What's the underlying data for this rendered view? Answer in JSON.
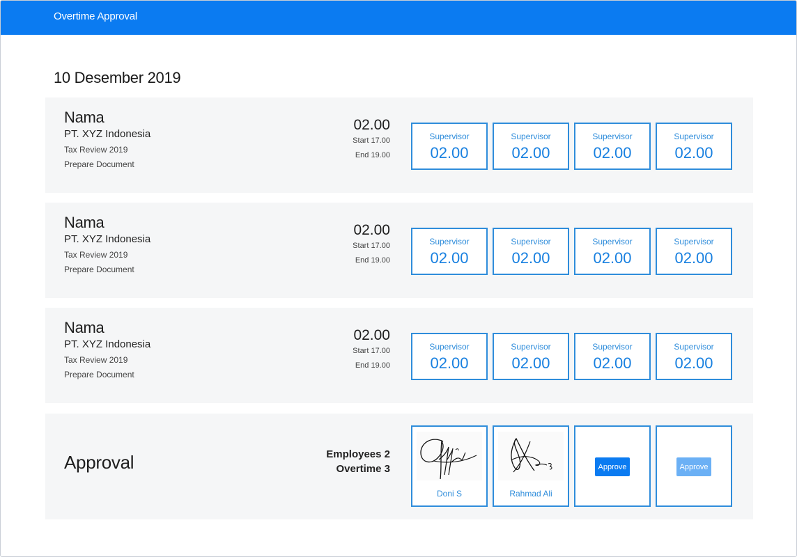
{
  "header": {
    "title": "Overtime Approval"
  },
  "date": "10 Desember 2019",
  "rows": [
    {
      "name": "Nama",
      "company": "PT. XYZ Indonesia",
      "task": "Tax Review 2019",
      "subtask": "Prepare Document",
      "total": "02.00",
      "start": "Start 17.00",
      "end": "End 19.00",
      "approvers": [
        {
          "label": "Supervisor",
          "value": "02.00"
        },
        {
          "label": "Supervisor",
          "value": "02.00"
        },
        {
          "label": "Supervisor",
          "value": "02.00"
        },
        {
          "label": "Supervisor",
          "value": "02.00"
        }
      ]
    },
    {
      "name": "Nama",
      "company": "PT. XYZ Indonesia",
      "task": "Tax Review 2019",
      "subtask": "Prepare Document",
      "total": "02.00",
      "start": "Start 17.00",
      "end": "End 19.00",
      "approvers": [
        {
          "label": "Supervisor",
          "value": "02.00"
        },
        {
          "label": "Supervisor",
          "value": "02.00"
        },
        {
          "label": "Supervisor",
          "value": "02.00"
        },
        {
          "label": "Supervisor",
          "value": "02.00"
        }
      ]
    },
    {
      "name": "Nama",
      "company": "PT. XYZ Indonesia",
      "task": "Tax Review 2019",
      "subtask": "Prepare Document",
      "total": "02.00",
      "start": "Start 17.00",
      "end": "End 19.00",
      "approvers": [
        {
          "label": "Supervisor",
          "value": "02.00"
        },
        {
          "label": "Supervisor",
          "value": "02.00"
        },
        {
          "label": "Supervisor",
          "value": "02.00"
        },
        {
          "label": "Supervisor",
          "value": "02.00"
        }
      ]
    }
  ],
  "approval": {
    "title": "Approval",
    "employees": "Employees 2",
    "overtime": "Overtime 3",
    "signers": [
      {
        "name": "Doni S",
        "icon": "signature-icon"
      },
      {
        "name": "Rahmad Ali",
        "icon": "signature-icon"
      }
    ],
    "approve_label": "Approve",
    "approve_disabled_label": "Approve",
    "colors": {
      "accent": "#0b7bf1",
      "border": "#2f8ddb",
      "disabled": "#6bb0f5",
      "card": "#f5f6f7"
    }
  }
}
